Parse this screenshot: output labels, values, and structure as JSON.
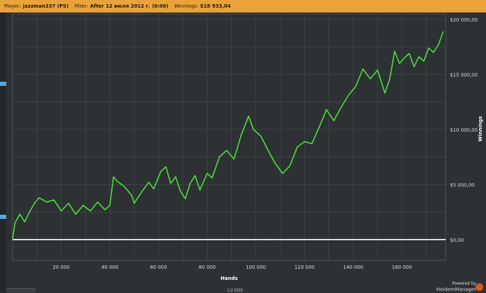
{
  "infobar": {
    "player_label": "Player:",
    "player_value": "jazzman337 (PS)",
    "filter_label": "Filter:",
    "filter_value": "After 12 июля 2012 г. (0:00)",
    "winnings_label": "Winnings:",
    "winnings_value": "$18 933,04"
  },
  "chart_data": {
    "type": "line",
    "xlabel": "Hands",
    "ylabel": "Winnings",
    "xlim": [
      0,
      178000
    ],
    "ylim": [
      -1900,
      20500
    ],
    "x_ticks": [
      20000,
      40000,
      60000,
      80000,
      100000,
      120000,
      140000,
      160000
    ],
    "x_tick_labels": [
      "20 000",
      "40 000",
      "60 000",
      "80 000",
      "100 000",
      "120 000",
      "140 000",
      "160 000"
    ],
    "y_ticks": [
      0,
      5000,
      10000,
      15000,
      20000
    ],
    "y_tick_labels": [
      "$0,00",
      "$5 000,00",
      "$10 000,00",
      "$15 000,00",
      "$20 000,00"
    ],
    "grid": true,
    "series": [
      {
        "color": "#4be03a",
        "x": [
          0,
          1000,
          3000,
          5000,
          7000,
          9000,
          11000,
          14000,
          17000,
          20000,
          23000,
          26000,
          29000,
          32000,
          35000,
          38000,
          40000,
          41500,
          43000,
          46000,
          49000,
          50000,
          53000,
          56000,
          58000,
          61000,
          63000,
          65000,
          67000,
          69000,
          71000,
          73000,
          75000,
          77000,
          80000,
          82000,
          85000,
          88000,
          91000,
          94000,
          97000,
          99000,
          102000,
          105000,
          108000,
          111000,
          114000,
          117000,
          120000,
          123000,
          126000,
          129000,
          132000,
          135000,
          138000,
          141000,
          144000,
          147000,
          150000,
          153000,
          155000,
          157000,
          159000,
          161000,
          163000,
          165000,
          167000,
          169000,
          171000,
          173000,
          175000,
          177000
        ],
        "y": [
          0,
          1500,
          2300,
          1600,
          2500,
          3300,
          3800,
          3400,
          3600,
          2600,
          3300,
          2300,
          3100,
          2600,
          3400,
          2700,
          3100,
          5700,
          5300,
          4800,
          4000,
          3300,
          4300,
          5200,
          4600,
          6200,
          6600,
          5100,
          5700,
          4400,
          3700,
          5100,
          5800,
          4500,
          6000,
          5600,
          7500,
          8100,
          7300,
          9500,
          11200,
          10000,
          9400,
          8100,
          6900,
          6000,
          6700,
          8400,
          8900,
          8700,
          10200,
          11800,
          10800,
          12000,
          13100,
          13900,
          15500,
          14600,
          15400,
          13300,
          14600,
          17100,
          16000,
          16500,
          16900,
          15700,
          16600,
          16200,
          17400,
          17000,
          17700,
          18900
        ]
      }
    ]
  },
  "footer": {
    "powered_by": "Powered by",
    "brand": "HoldemManager",
    "bottom_partial": "Cd Stilli"
  }
}
